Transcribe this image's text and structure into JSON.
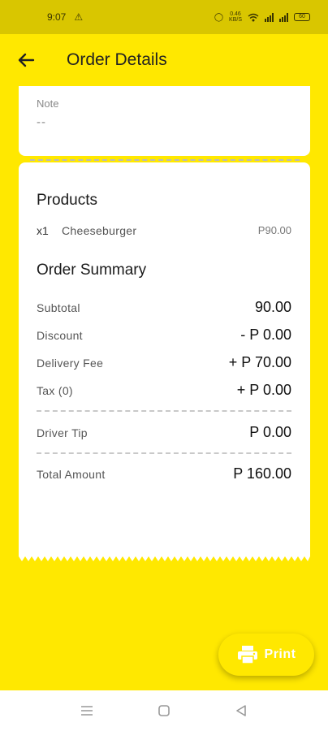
{
  "status_bar": {
    "time": "9:07",
    "alert_icon": "warning-icon",
    "data_rate": "0.46",
    "data_unit": "KB/S",
    "battery": "60"
  },
  "header": {
    "title": "Order Details",
    "back_icon": "arrow-left-icon"
  },
  "note": {
    "label": "Note",
    "value": "--"
  },
  "products": {
    "title": "Products",
    "items": [
      {
        "qty": "x1",
        "name": "Cheeseburger",
        "price": "P90.00"
      }
    ]
  },
  "summary": {
    "title": "Order Summary",
    "rows": [
      {
        "label": "Subtotal",
        "value": "90.00"
      },
      {
        "label": "Discount",
        "value": "- P 0.00"
      },
      {
        "label": "Delivery Fee",
        "value": "+ P 70.00"
      },
      {
        "label": "Tax (0)",
        "value": "+ P 0.00"
      }
    ],
    "tip": {
      "label": "Driver Tip",
      "value": "P 0.00"
    },
    "total": {
      "label": "Total Amount",
      "value": "P 160.00"
    }
  },
  "print_button": {
    "label": "Print",
    "icon": "printer-icon"
  },
  "nav": {
    "menu_icon": "menu-icon",
    "home_icon": "square-icon",
    "back_icon": "triangle-back-icon"
  },
  "colors": {
    "brand": "#FFE800",
    "status_bar": "#D9C600"
  }
}
